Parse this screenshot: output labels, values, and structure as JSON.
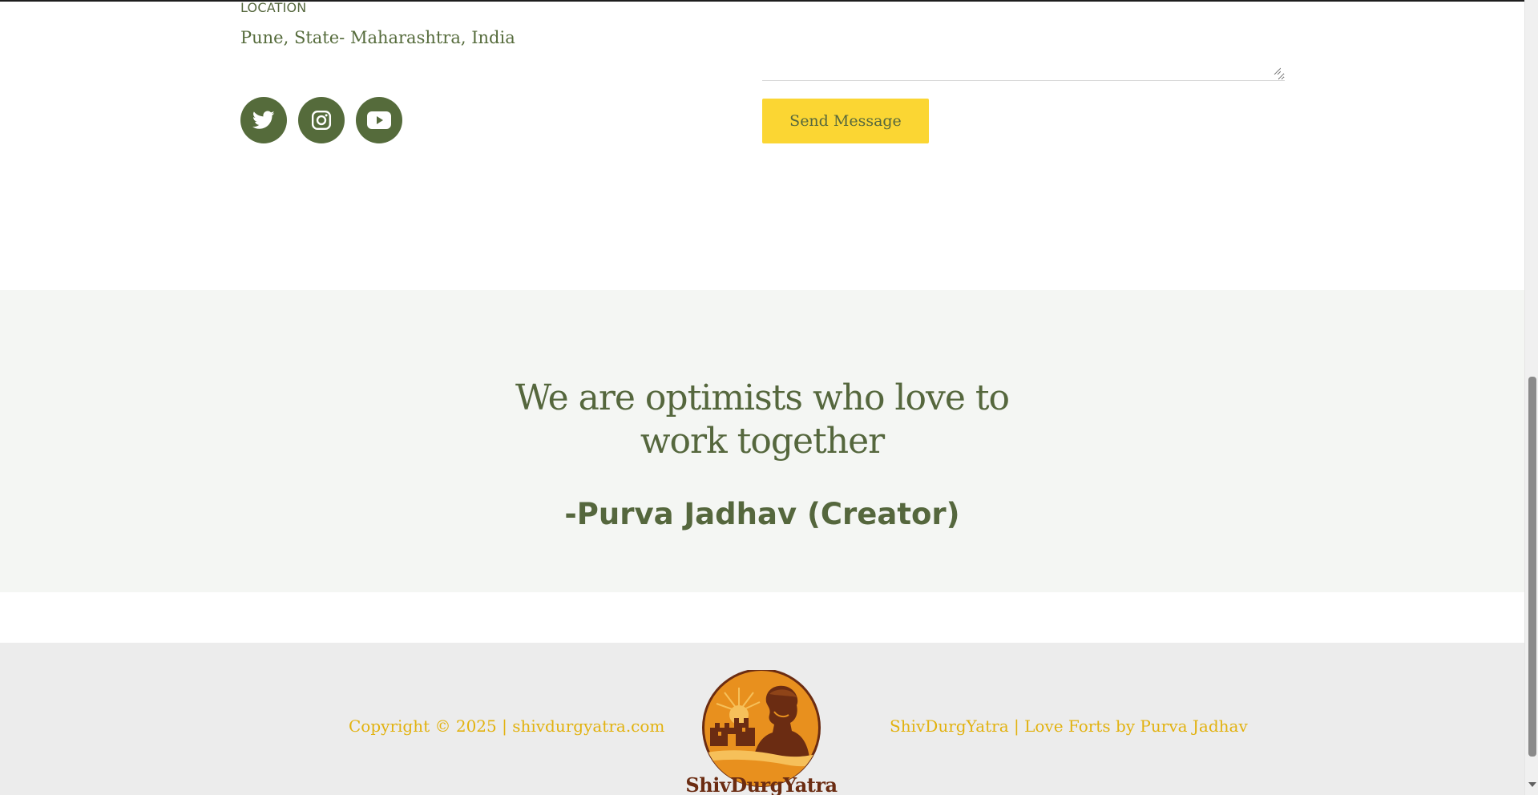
{
  "contact": {
    "location_label": "LOCATION",
    "location_value": "Pune, State- Maharashtra, India"
  },
  "socials": [
    {
      "icon": "twitter-icon"
    },
    {
      "icon": "instagram-icon"
    },
    {
      "icon": "youtube-icon"
    }
  ],
  "form": {
    "message_value": "",
    "send_label": "Send Message"
  },
  "quote": {
    "line1": "We are optimists who love to",
    "line2": "work together",
    "author": "-Purva Jadhav (Creator)"
  },
  "footer": {
    "copyright": "Copyright © 2025 | shivdurgyatra.com",
    "tagline": "ShivDurgYatra | Love Forts by Purva Jadhav",
    "logo_text": "ShivDurgYatra"
  },
  "colors": {
    "primary_green": "#556b3b",
    "button_yellow": "#fbd633",
    "footer_gold": "#e2b20f",
    "logo_orange": "#e8901e",
    "logo_brown": "#6b2c12"
  }
}
